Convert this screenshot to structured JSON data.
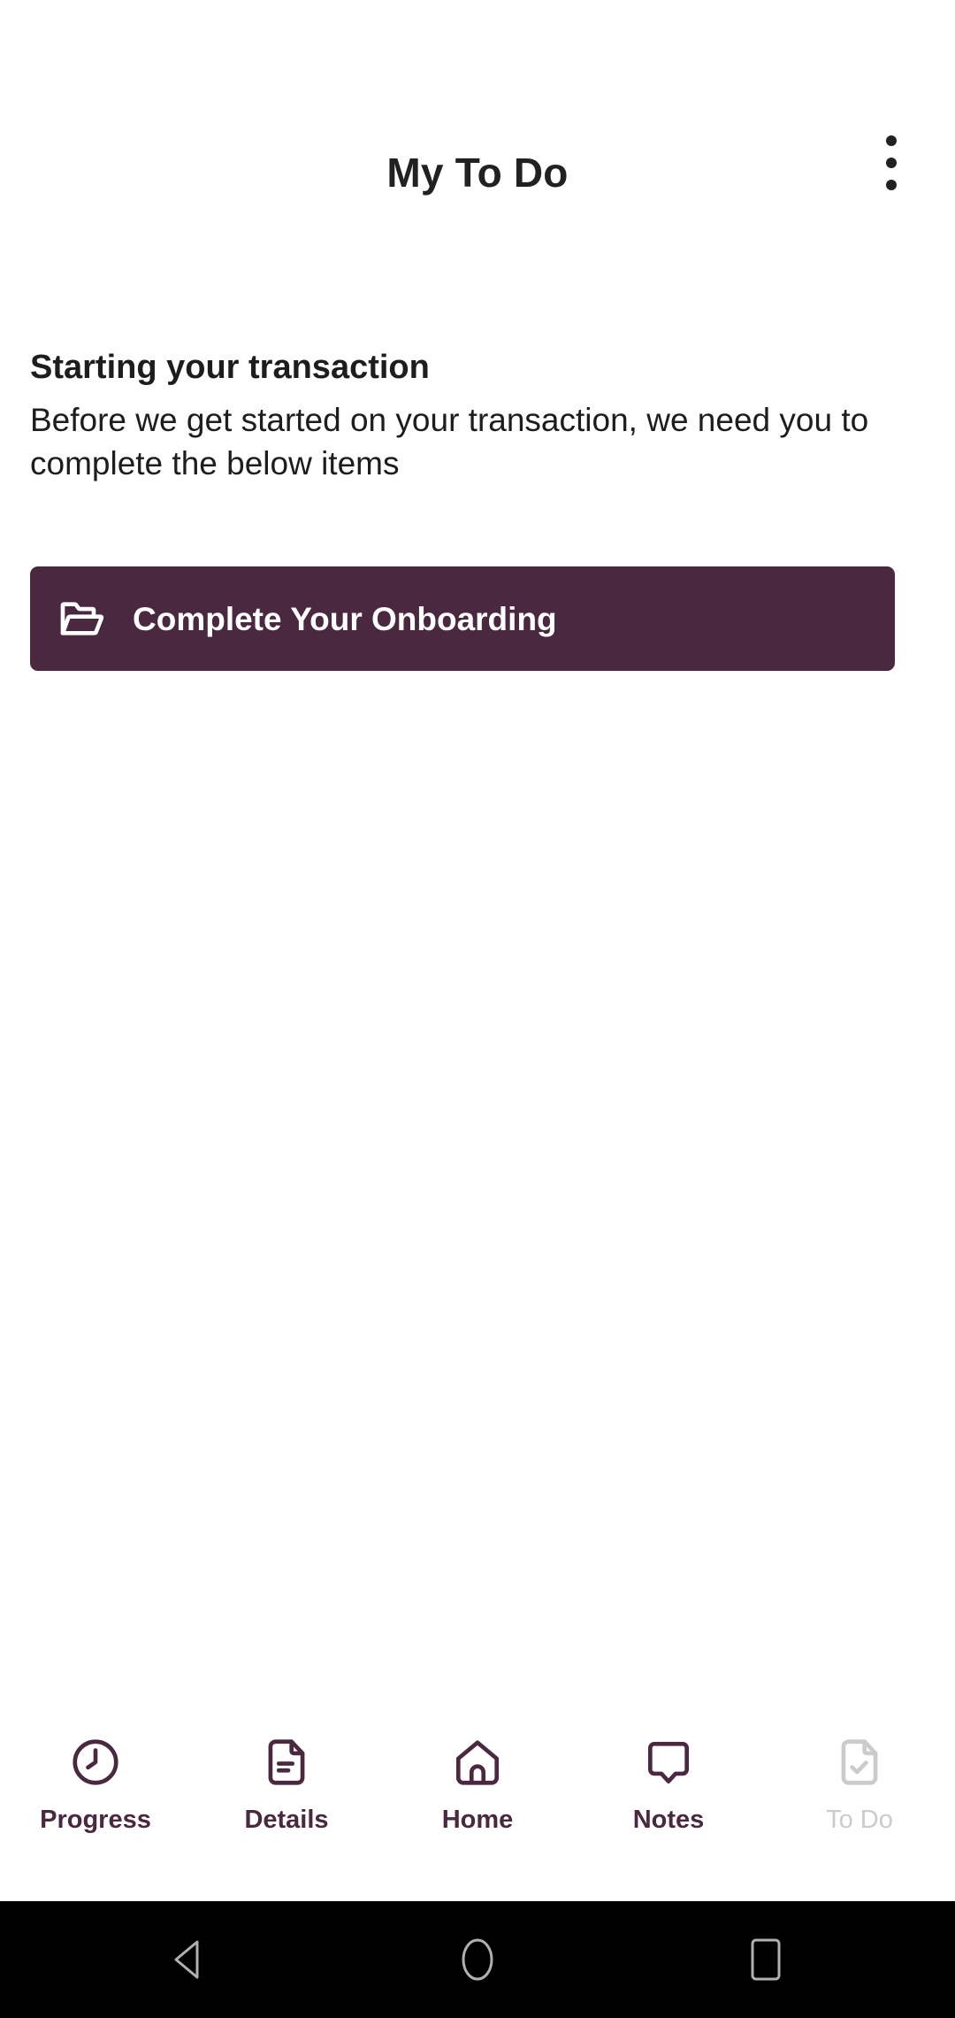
{
  "appbar": {
    "title": "My To Do",
    "overflow_menu_icon": "more-vertical-icon"
  },
  "content": {
    "heading": "Starting your transaction",
    "body": "Before we get started on your transaction, we need you to complete the below items",
    "action_button": {
      "label": "Complete Your Onboarding",
      "icon": "open-folder-icon",
      "background_color": "#4a2840",
      "text_color": "#ffffff"
    }
  },
  "tabbar": {
    "active_tab": "To Do",
    "active_color": "#cbcbcb",
    "inactive_color": "#4a2840",
    "items": [
      {
        "label": "Progress",
        "icon": "clock-icon"
      },
      {
        "label": "Details",
        "icon": "document-lines-icon"
      },
      {
        "label": "Home",
        "icon": "home-icon"
      },
      {
        "label": "Notes",
        "icon": "speech-bubble-icon"
      },
      {
        "label": "To Do",
        "icon": "document-check-icon"
      }
    ]
  },
  "system_nav": {
    "background_color": "#000000",
    "icon_color": "#b0b0b0",
    "buttons": [
      {
        "name": "back",
        "icon": "triangle-left-icon"
      },
      {
        "name": "home",
        "icon": "circle-icon"
      },
      {
        "name": "recents",
        "icon": "square-icon"
      }
    ]
  }
}
